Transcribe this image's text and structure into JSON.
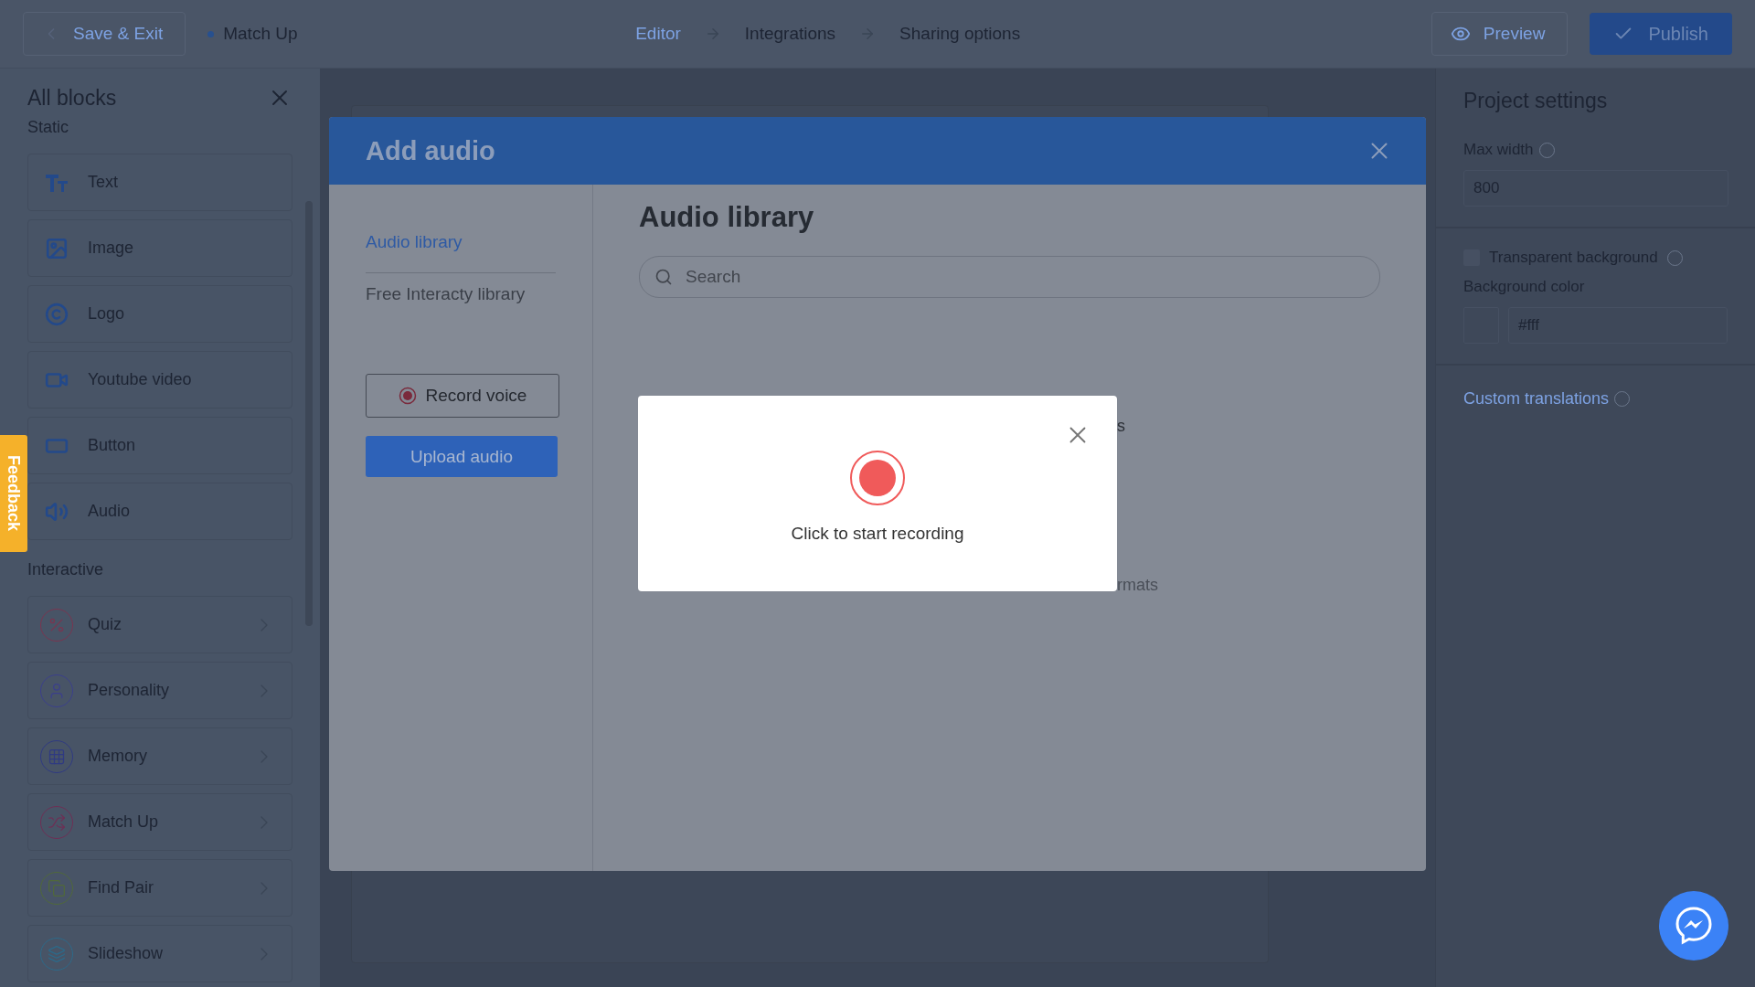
{
  "topbar": {
    "save_exit": "Save & Exit",
    "project_name": "Match Up",
    "steps": [
      {
        "label": "Editor",
        "selected": true
      },
      {
        "label": "Integrations",
        "selected": false
      },
      {
        "label": "Sharing options",
        "selected": false
      }
    ],
    "preview": "Preview",
    "publish": "Publish"
  },
  "sidebar": {
    "title": "All blocks",
    "sections": [
      {
        "title": "Static",
        "items": [
          {
            "label": "Text",
            "kind": "text"
          },
          {
            "label": "Image",
            "kind": "image"
          },
          {
            "label": "Logo",
            "kind": "logo"
          },
          {
            "label": "Youtube video",
            "kind": "video"
          },
          {
            "label": "Button",
            "kind": "button"
          },
          {
            "label": "Audio",
            "kind": "audio"
          }
        ]
      },
      {
        "title": "Interactive",
        "items": [
          {
            "label": "Quiz",
            "kind": "quiz",
            "color": "#7a3550"
          },
          {
            "label": "Personality",
            "kind": "personality",
            "color": "#3b3f8c"
          },
          {
            "label": "Memory",
            "kind": "memory",
            "color": "#2f3a82"
          },
          {
            "label": "Match Up",
            "kind": "matchup",
            "color": "#6e2f55"
          },
          {
            "label": "Find Pair",
            "kind": "findpair",
            "color": "#50693a"
          },
          {
            "label": "Slideshow",
            "kind": "slideshow",
            "color": "#2c6a8a"
          }
        ]
      }
    ]
  },
  "feedback": "Feedback",
  "modal": {
    "title": "Add audio",
    "nav": [
      {
        "label": "Audio library",
        "selected": true
      },
      {
        "label": "Free Interacty library",
        "selected": false
      }
    ],
    "record_button": "Record voice",
    "upload_button": "Upload audio",
    "heading": "Audio library",
    "search": {
      "placeholder": "Search"
    },
    "fragments": [
      "s",
      "rmats"
    ]
  },
  "recorder": {
    "caption": "Click to start recording"
  },
  "settings": {
    "title": "Project settings",
    "max_width": {
      "label": "Max width",
      "value": "800"
    },
    "transparent_background": {
      "label": "Transparent background",
      "checked": false
    },
    "background_color": {
      "label": "Background color",
      "value": "#fff"
    },
    "custom_translations": "Custom translations"
  }
}
